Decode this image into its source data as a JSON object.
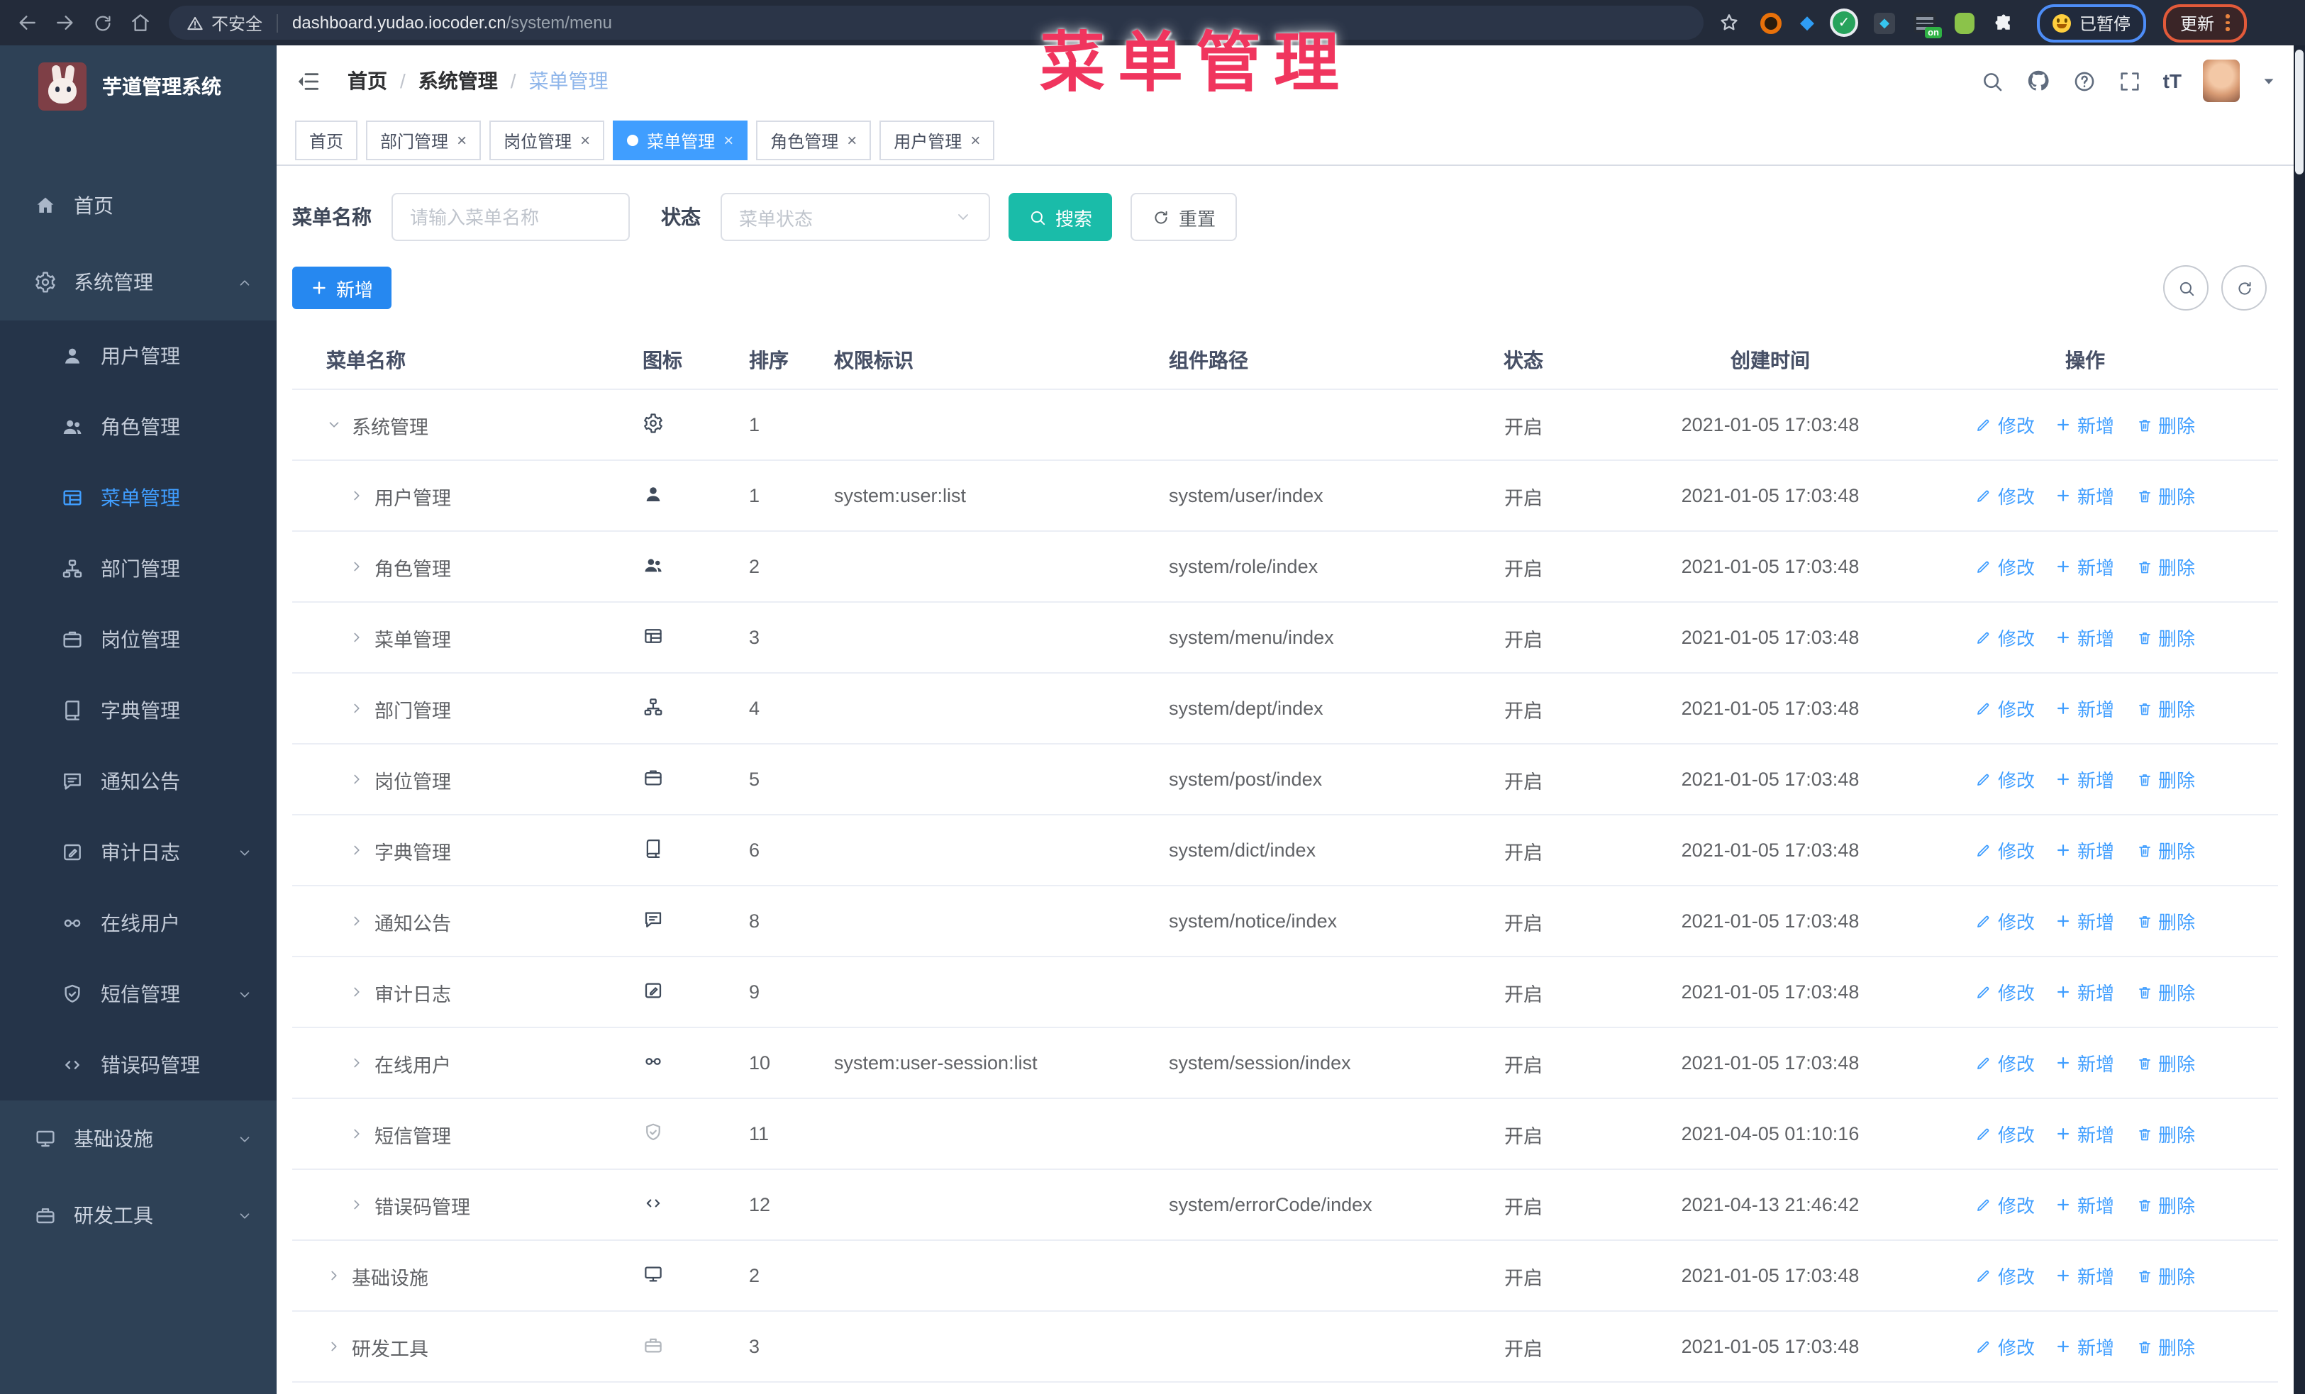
{
  "browser": {
    "security_label": "不安全",
    "url_host": "dashboard.yudao.iocoder.cn",
    "url_path": "/system/menu",
    "ext_on_badge": "on",
    "paused_badge_label": "已暂停",
    "update_badge_label": "更新"
  },
  "overlay_title": "菜单管理",
  "colors": {
    "primary": "#409eff",
    "search_teal": "#1abca9",
    "add_blue": "#2688f0",
    "overlay_pink": "#f0355e",
    "sidebar_bg": "#2e4156",
    "submenu_bg": "#253449"
  },
  "sidebar": {
    "app_title": "芋道管理系统",
    "items": [
      {
        "label": "首页",
        "icon": "home-icon",
        "level": 0
      },
      {
        "label": "系统管理",
        "icon": "gear-icon",
        "level": 0,
        "arrow": "up"
      },
      {
        "label": "用户管理",
        "icon": "user-icon",
        "level": 1
      },
      {
        "label": "角色管理",
        "icon": "users-icon",
        "level": 1
      },
      {
        "label": "菜单管理",
        "icon": "menu-icon",
        "level": 1,
        "active": true
      },
      {
        "label": "部门管理",
        "icon": "tree-icon",
        "level": 1
      },
      {
        "label": "岗位管理",
        "icon": "badge-icon",
        "level": 1
      },
      {
        "label": "字典管理",
        "icon": "book-icon",
        "level": 1
      },
      {
        "label": "通知公告",
        "icon": "message-icon",
        "level": 1
      },
      {
        "label": "审计日志",
        "icon": "edit-icon",
        "level": 1,
        "arrow": "down"
      },
      {
        "label": "在线用户",
        "icon": "online-icon",
        "level": 1
      },
      {
        "label": "短信管理",
        "icon": "shield-icon",
        "level": 1,
        "arrow": "down"
      },
      {
        "label": "错误码管理",
        "icon": "code-icon",
        "level": 1
      },
      {
        "label": "基础设施",
        "icon": "monitor-icon",
        "level": 0,
        "arrow": "down"
      },
      {
        "label": "研发工具",
        "icon": "toolbox-icon",
        "level": 0,
        "arrow": "down"
      }
    ]
  },
  "header": {
    "breadcrumb": [
      "首页",
      "系统管理",
      "菜单管理"
    ],
    "font_size_icon_label": "tT"
  },
  "tabs": [
    {
      "label": "首页",
      "closable": false,
      "active": false
    },
    {
      "label": "部门管理",
      "closable": true,
      "active": false
    },
    {
      "label": "岗位管理",
      "closable": true,
      "active": false
    },
    {
      "label": "菜单管理",
      "closable": true,
      "active": true
    },
    {
      "label": "角色管理",
      "closable": true,
      "active": false
    },
    {
      "label": "用户管理",
      "closable": true,
      "active": false
    }
  ],
  "filters": {
    "name_label": "菜单名称",
    "name_placeholder": "请输入菜单名称",
    "status_label": "状态",
    "status_placeholder": "菜单状态",
    "search_label": "搜索",
    "reset_label": "重置"
  },
  "toolbar": {
    "add_label": "新增"
  },
  "table": {
    "columns": [
      "菜单名称",
      "图标",
      "排序",
      "权限标识",
      "组件路径",
      "状态",
      "创建时间",
      "操作"
    ],
    "action_labels": {
      "edit": "修改",
      "add": "新增",
      "delete": "删除"
    },
    "rows": [
      {
        "name": "系统管理",
        "icon": "gear-icon",
        "level": 0,
        "arrow": "down",
        "sort": "1",
        "permission": "",
        "path": "",
        "status": "开启",
        "time": "2021-01-05 17:03:48"
      },
      {
        "name": "用户管理",
        "icon": "user-icon",
        "level": 1,
        "arrow": "right",
        "sort": "1",
        "permission": "system:user:list",
        "path": "system/user/index",
        "status": "开启",
        "time": "2021-01-05 17:03:48"
      },
      {
        "name": "角色管理",
        "icon": "users-icon",
        "level": 1,
        "arrow": "right",
        "sort": "2",
        "permission": "",
        "path": "system/role/index",
        "status": "开启",
        "time": "2021-01-05 17:03:48"
      },
      {
        "name": "菜单管理",
        "icon": "menu-icon",
        "level": 1,
        "arrow": "right",
        "sort": "3",
        "permission": "",
        "path": "system/menu/index",
        "status": "开启",
        "time": "2021-01-05 17:03:48"
      },
      {
        "name": "部门管理",
        "icon": "tree-icon",
        "level": 1,
        "arrow": "right",
        "sort": "4",
        "permission": "",
        "path": "system/dept/index",
        "status": "开启",
        "time": "2021-01-05 17:03:48"
      },
      {
        "name": "岗位管理",
        "icon": "badge-icon",
        "level": 1,
        "arrow": "right",
        "sort": "5",
        "permission": "",
        "path": "system/post/index",
        "status": "开启",
        "time": "2021-01-05 17:03:48"
      },
      {
        "name": "字典管理",
        "icon": "book-icon",
        "level": 1,
        "arrow": "right",
        "sort": "6",
        "permission": "",
        "path": "system/dict/index",
        "status": "开启",
        "time": "2021-01-05 17:03:48"
      },
      {
        "name": "通知公告",
        "icon": "message-icon",
        "level": 1,
        "arrow": "right",
        "sort": "8",
        "permission": "",
        "path": "system/notice/index",
        "status": "开启",
        "time": "2021-01-05 17:03:48"
      },
      {
        "name": "审计日志",
        "icon": "edit-icon",
        "level": 1,
        "arrow": "right",
        "sort": "9",
        "permission": "",
        "path": "",
        "status": "开启",
        "time": "2021-01-05 17:03:48"
      },
      {
        "name": "在线用户",
        "icon": "online-icon",
        "level": 1,
        "arrow": "right",
        "sort": "10",
        "permission": "system:user-session:list",
        "path": "system/session/index",
        "status": "开启",
        "time": "2021-01-05 17:03:48"
      },
      {
        "name": "短信管理",
        "icon": "shield-icon",
        "level": 1,
        "arrow": "right",
        "sort": "11",
        "permission": "",
        "path": "",
        "status": "开启",
        "time": "2021-04-05 01:10:16",
        "muted_icon": true
      },
      {
        "name": "错误码管理",
        "icon": "code-icon",
        "level": 1,
        "arrow": "right",
        "sort": "12",
        "permission": "",
        "path": "system/errorCode/index",
        "status": "开启",
        "time": "2021-04-13 21:46:42"
      },
      {
        "name": "基础设施",
        "icon": "monitor-icon",
        "level": 0,
        "arrow": "right",
        "sort": "2",
        "permission": "",
        "path": "",
        "status": "开启",
        "time": "2021-01-05 17:03:48"
      },
      {
        "name": "研发工具",
        "icon": "toolbox-icon",
        "level": 0,
        "arrow": "right",
        "sort": "3",
        "permission": "",
        "path": "",
        "status": "开启",
        "time": "2021-01-05 17:03:48",
        "muted_icon": true
      }
    ]
  }
}
